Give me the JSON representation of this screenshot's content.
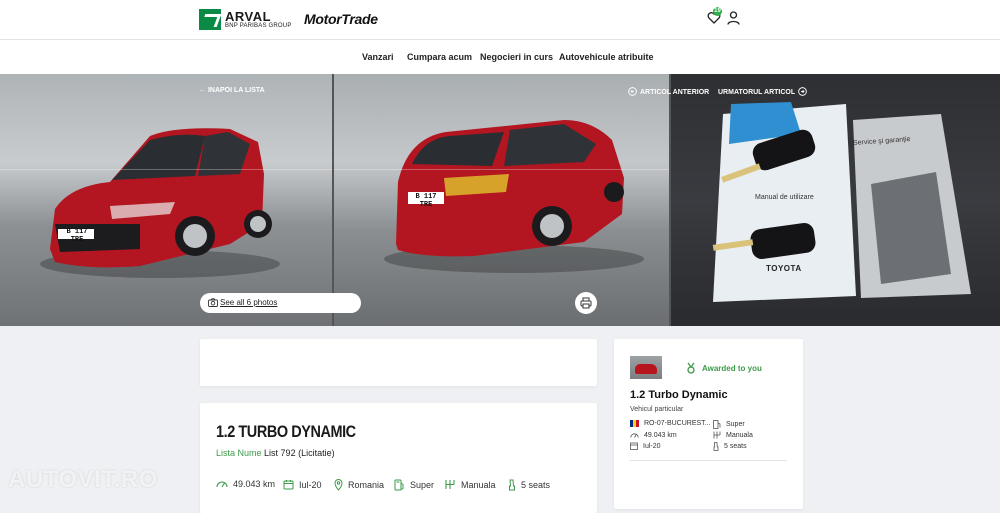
{
  "header": {
    "brand_arval": "ARVAL",
    "brand_arval_sub": "BNP PARIBAS GROUP",
    "brand_motortrade": "MotorTrade",
    "favorites_count": "19"
  },
  "nav": {
    "items": [
      {
        "label": "Vanzari"
      },
      {
        "label": "Cumpara acum"
      },
      {
        "label": "Negocieri in curs"
      },
      {
        "label": "Autovehicule atribuite"
      }
    ]
  },
  "gallery": {
    "back_label": "← INAPOI LA LISTA",
    "prev_label": "ARTICOL ANTERIOR",
    "next_label": "URMATORUL ARTICOL",
    "see_all_label": "See all 6 photos",
    "plate_front": "B 117 TRE",
    "plate_rear": "B 117 TRE",
    "manual_text": "Manual de utilizare",
    "service_text": "Service şi garanție",
    "toyota_text": "TOYOTA"
  },
  "listing": {
    "title": "1.2 TURBO DYNAMIC",
    "list_name_label": "Lista Nume",
    "list_value": "List 792 (Licitatie)",
    "specs": {
      "mileage": "49.043 km",
      "date": "Iul-20",
      "country": "Romania",
      "fuel": "Super",
      "gearbox": "Manuala",
      "seats": "5 seats"
    }
  },
  "sidebar_card": {
    "awarded_label": "Awarded to you",
    "title": "1.2 Turbo Dynamic",
    "subtitle": "Vehicul particular",
    "location": "RO-07-BUCUREST...",
    "fuel": "Super",
    "mileage": "49.043 km",
    "gearbox": "Manuala",
    "date": "Iul-20",
    "seats": "5 seats"
  },
  "watermark": "AUTOVIT.RO",
  "colors": {
    "accent_green": "#3e9a4a",
    "car_red": "#b7161f",
    "arval_green": "#0a8a45"
  }
}
